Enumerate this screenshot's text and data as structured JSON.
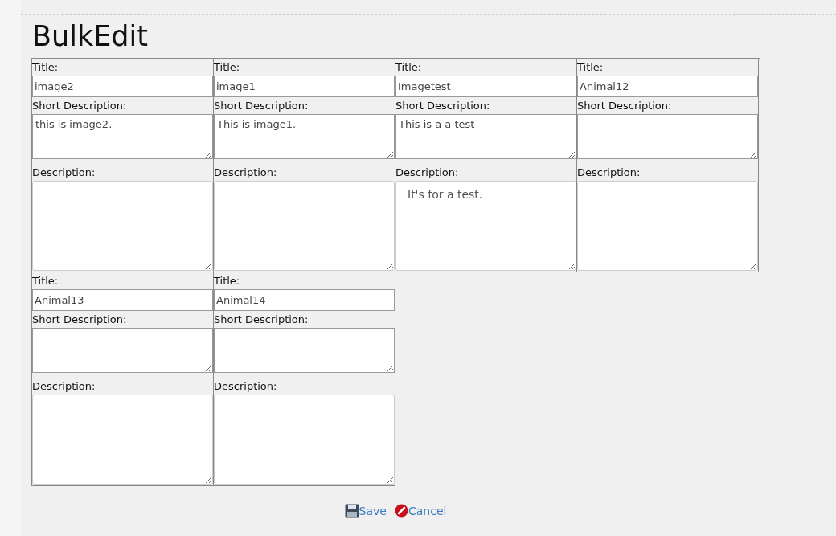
{
  "page_title": "BulkEdit",
  "items": [
    {
      "title_label": "Title:",
      "title": "image2",
      "short_label": "Short Description:",
      "short_description": "this is image2.",
      "description_label": "Description:"
    },
    {
      "title_label": "Title:",
      "title": "image1",
      "short_label": "Short Description:",
      "short_description": "This is image1.",
      "description_label": "Description:"
    },
    {
      "title_label": "Title:",
      "title": "Imagetest",
      "short_label": "Short Description:",
      "short_description": "This is a a test",
      "description_label": "Description:",
      "description": "It's for a test."
    },
    {
      "title_label": "Title:",
      "title": "Animal12",
      "short_label": "Short Description:",
      "description_label": "Description:"
    },
    {
      "title_label": "Title:",
      "title": "Animal13",
      "short_label": "Short Description:",
      "description_label": "Description:"
    },
    {
      "title_label": "Title:",
      "title": "Animal14",
      "short_label": "Short Description:",
      "description_label": "Description:"
    }
  ],
  "actions": [
    {
      "kind": "save",
      "label": "Save"
    },
    {
      "kind": "cancel",
      "label": "Cancel"
    }
  ]
}
